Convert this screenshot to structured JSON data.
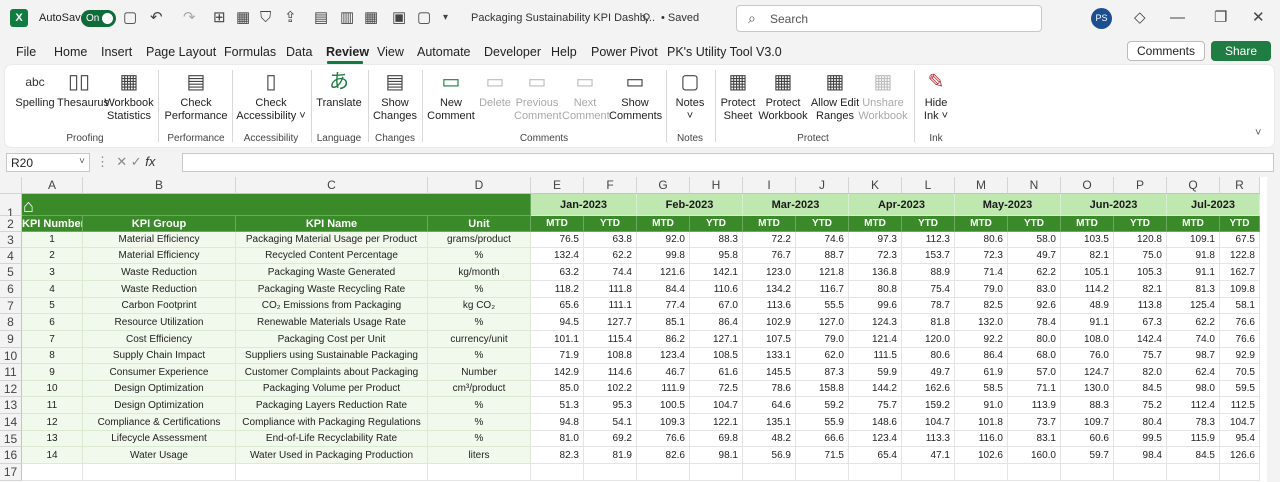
{
  "app": {
    "logo": "X",
    "autosave_label": "AutoSave",
    "autosave_state": "On",
    "title": "Packaging Sustainability KPI Dashb...",
    "status": "• Saved",
    "search_placeholder": "Search",
    "user_initials": "PS"
  },
  "menu": [
    "File",
    "Home",
    "Insert",
    "Page Layout",
    "Formulas",
    "Data",
    "Review",
    "View",
    "Automate",
    "Developer",
    "Help",
    "Power Pivot",
    "PK's Utility Tool V3.0"
  ],
  "menu_active": "Review",
  "buttons": {
    "comments": "Comments",
    "share": "Share"
  },
  "ribbon": {
    "spelling": [
      "abc",
      "Spelling"
    ],
    "thesaurus": "Thesaurus",
    "workbook_statistics": [
      "Workbook",
      "Statistics"
    ],
    "check_performance": [
      "Check",
      "Performance"
    ],
    "check_accessibility": [
      "Check",
      "Accessibility ˅"
    ],
    "translate": "Translate",
    "show_changes": [
      "Show",
      "Changes"
    ],
    "new_comment": [
      "New",
      "Comment"
    ],
    "delete": "Delete",
    "previous_comment": [
      "Previous",
      "Comment"
    ],
    "next_comment": [
      "Next",
      "Comment"
    ],
    "show_comments": [
      "Show",
      "Comments"
    ],
    "notes": [
      "Notes",
      "˅"
    ],
    "protect_sheet": [
      "Protect",
      "Sheet"
    ],
    "protect_workbook": [
      "Protect",
      "Workbook"
    ],
    "allow_edit_ranges": [
      "Allow Edit",
      "Ranges"
    ],
    "unshare_workbook": [
      "Unshare",
      "Workbook"
    ],
    "hide_ink": [
      "Hide",
      "Ink ˅"
    ],
    "groups": {
      "proofing": "Proofing",
      "performance": "Performance",
      "accessibility": "Accessibility",
      "language": "Language",
      "changes": "Changes",
      "comments": "Comments",
      "notes": "Notes",
      "protect": "Protect",
      "ink": "Ink"
    }
  },
  "formula_bar": {
    "name_box": "R20",
    "fx": "fx",
    "value": ""
  },
  "columns": [
    "A",
    "B",
    "C",
    "D",
    "E",
    "F",
    "G",
    "H",
    "I",
    "J",
    "K",
    "L",
    "M",
    "N",
    "O",
    "P",
    "Q",
    "R"
  ],
  "rows": [
    "1",
    "2",
    "3",
    "4",
    "5",
    "6",
    "7",
    "8",
    "9",
    "10",
    "11",
    "12",
    "13",
    "14",
    "15",
    "16",
    "17"
  ],
  "sheet": {
    "headers": [
      "KPI Number",
      "KPI Group",
      "KPI Name",
      "Unit"
    ],
    "months": [
      "Jan-2023",
      "Feb-2023",
      "Mar-2023",
      "Apr-2023",
      "May-2023",
      "Jun-2023",
      "Jul-2023"
    ],
    "subheaders": [
      "MTD",
      "YTD"
    ],
    "kpis": [
      {
        "num": "1",
        "group": "Material Efficiency",
        "name": "Packaging Material Usage per Product",
        "unit": "grams/product",
        "values": [
          "76.5",
          "63.8",
          "92.0",
          "88.3",
          "72.2",
          "74.6",
          "97.3",
          "112.3",
          "80.6",
          "58.0",
          "103.5",
          "120.8",
          "109.1",
          "67.5"
        ]
      },
      {
        "num": "2",
        "group": "Material Efficiency",
        "name": "Recycled Content Percentage",
        "unit": "%",
        "values": [
          "132.4",
          "62.2",
          "99.8",
          "95.8",
          "76.7",
          "88.7",
          "72.3",
          "153.7",
          "72.3",
          "49.7",
          "82.1",
          "75.0",
          "91.8",
          "122.8"
        ]
      },
      {
        "num": "3",
        "group": "Waste Reduction",
        "name": "Packaging Waste Generated",
        "unit": "kg/month",
        "values": [
          "63.2",
          "74.4",
          "121.6",
          "142.1",
          "123.0",
          "121.8",
          "136.8",
          "88.9",
          "71.4",
          "62.2",
          "105.1",
          "105.3",
          "91.1",
          "162.7"
        ]
      },
      {
        "num": "4",
        "group": "Waste Reduction",
        "name": "Packaging Waste Recycling Rate",
        "unit": "%",
        "values": [
          "118.2",
          "111.8",
          "84.4",
          "110.6",
          "134.2",
          "116.7",
          "80.8",
          "75.4",
          "79.0",
          "83.0",
          "114.2",
          "82.1",
          "81.3",
          "109.8"
        ]
      },
      {
        "num": "5",
        "group": "Carbon Footprint",
        "name": "CO₂ Emissions from Packaging",
        "unit": "kg CO₂",
        "values": [
          "65.6",
          "111.1",
          "77.4",
          "67.0",
          "113.6",
          "55.5",
          "99.6",
          "78.7",
          "82.5",
          "92.6",
          "48.9",
          "113.8",
          "125.4",
          "58.1"
        ]
      },
      {
        "num": "6",
        "group": "Resource Utilization",
        "name": "Renewable Materials Usage Rate",
        "unit": "%",
        "values": [
          "94.5",
          "127.7",
          "85.1",
          "86.4",
          "102.9",
          "127.0",
          "124.3",
          "81.8",
          "132.0",
          "78.4",
          "91.1",
          "67.3",
          "62.2",
          "76.6"
        ]
      },
      {
        "num": "7",
        "group": "Cost Efficiency",
        "name": "Packaging Cost per Unit",
        "unit": "currency/unit",
        "values": [
          "101.1",
          "115.4",
          "86.2",
          "127.1",
          "107.5",
          "79.0",
          "121.4",
          "120.0",
          "92.2",
          "80.0",
          "108.0",
          "142.4",
          "74.0",
          "76.6"
        ]
      },
      {
        "num": "8",
        "group": "Supply Chain Impact",
        "name": "Suppliers using Sustainable Packaging",
        "unit": "%",
        "values": [
          "71.9",
          "108.8",
          "123.4",
          "108.5",
          "133.1",
          "62.0",
          "111.5",
          "80.6",
          "86.4",
          "68.0",
          "76.0",
          "75.7",
          "98.7",
          "92.9"
        ]
      },
      {
        "num": "9",
        "group": "Consumer Experience",
        "name": "Customer Complaints about Packaging",
        "unit": "Number",
        "values": [
          "142.9",
          "114.6",
          "46.7",
          "61.6",
          "145.5",
          "87.3",
          "59.9",
          "49.7",
          "61.9",
          "57.0",
          "124.7",
          "82.0",
          "62.4",
          "70.5"
        ]
      },
      {
        "num": "10",
        "group": "Design Optimization",
        "name": "Packaging Volume per Product",
        "unit": "cm³/product",
        "values": [
          "85.0",
          "102.2",
          "111.9",
          "72.5",
          "78.6",
          "158.8",
          "144.2",
          "162.6",
          "58.5",
          "71.1",
          "130.0",
          "84.5",
          "98.0",
          "59.5"
        ]
      },
      {
        "num": "11",
        "group": "Design Optimization",
        "name": "Packaging Layers Reduction Rate",
        "unit": "%",
        "values": [
          "51.3",
          "95.3",
          "100.5",
          "104.7",
          "64.6",
          "59.2",
          "75.7",
          "159.2",
          "91.0",
          "113.9",
          "88.3",
          "75.2",
          "112.4",
          "112.5"
        ]
      },
      {
        "num": "12",
        "group": "Compliance & Certifications",
        "name": "Compliance with Packaging Regulations",
        "unit": "%",
        "values": [
          "94.8",
          "54.1",
          "109.3",
          "122.1",
          "135.1",
          "55.9",
          "148.6",
          "104.7",
          "101.8",
          "73.7",
          "109.7",
          "80.4",
          "78.3",
          "104.7"
        ]
      },
      {
        "num": "13",
        "group": "Lifecycle Assessment",
        "name": "End-of-Life Recyclability Rate",
        "unit": "%",
        "values": [
          "81.0",
          "69.2",
          "76.6",
          "69.8",
          "48.2",
          "66.6",
          "123.4",
          "113.3",
          "116.0",
          "83.1",
          "60.6",
          "99.5",
          "115.9",
          "95.4"
        ]
      },
      {
        "num": "14",
        "group": "Water Usage",
        "name": "Water Used in Packaging Production",
        "unit": "liters",
        "values": [
          "82.3",
          "81.9",
          "82.6",
          "98.1",
          "56.9",
          "71.5",
          "65.4",
          "47.1",
          "102.6",
          "160.0",
          "59.7",
          "98.4",
          "84.5",
          "126.6"
        ]
      }
    ]
  },
  "colors": {
    "excel_green": "#107c41",
    "header_dark": "#3a8a2a",
    "header_light": "#bfe8b0",
    "body_tint": "#f1f8ec"
  }
}
